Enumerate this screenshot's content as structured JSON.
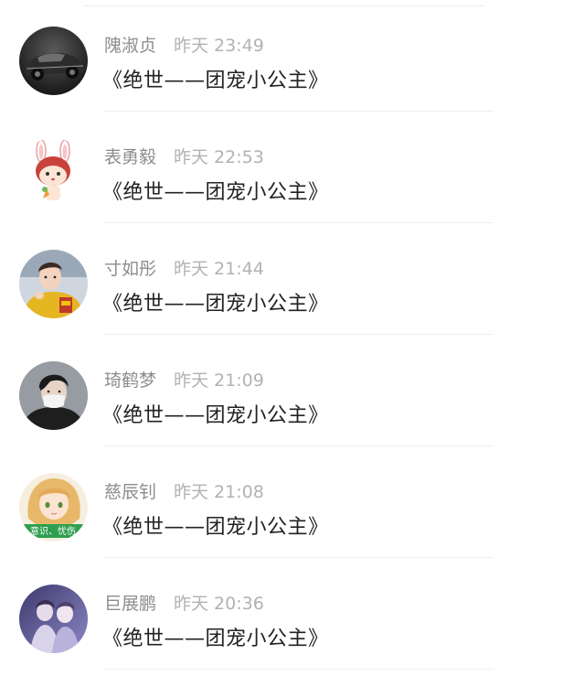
{
  "comments": [
    {
      "username": "隗淑贞",
      "time": "昨天 23:49",
      "text": "《绝世——团宠小公主》",
      "avatar": "sports-car-avatar"
    },
    {
      "username": "表勇毅",
      "time": "昨天 22:53",
      "text": "《绝世——团宠小公主》",
      "avatar": "bunny-mascot-avatar"
    },
    {
      "username": "寸如彤",
      "time": "昨天 21:44",
      "text": "《绝世——团宠小公主》",
      "avatar": "boy-yellow-hoodie-avatar"
    },
    {
      "username": "琦鹤梦",
      "time": "昨天 21:09",
      "text": "《绝世——团宠小公主》",
      "avatar": "masked-person-avatar"
    },
    {
      "username": "慈辰钊",
      "time": "昨天 21:08",
      "text": "《绝世——团宠小公主》",
      "avatar": "anime-girl-avatar",
      "avatar_banner_text": "意识、忧伤"
    },
    {
      "username": "巨展鹏",
      "time": "昨天 20:36",
      "text": "《绝世——团宠小公主》",
      "avatar": "purple-photo-avatar"
    }
  ],
  "colors": {
    "background": "#ffffff",
    "username": "#8d8d8d",
    "timestamp": "#b2b2b2",
    "comment_text": "#222222",
    "divider": "#efefef"
  }
}
